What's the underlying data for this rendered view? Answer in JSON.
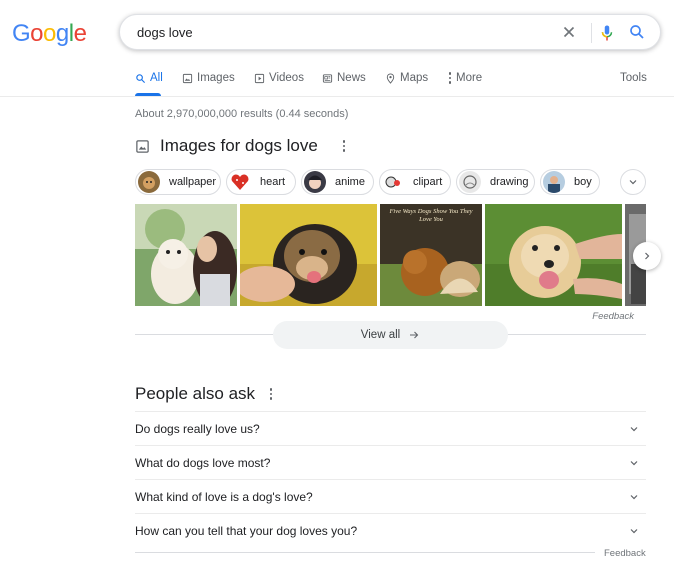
{
  "logo": {
    "letters": [
      "G",
      "o",
      "o",
      "g",
      "l",
      "e"
    ],
    "colors": [
      "#4285f4",
      "#ea4335",
      "#fbbc05",
      "#4285f4",
      "#34a853",
      "#ea4335"
    ]
  },
  "search": {
    "query": "dogs love"
  },
  "tabs": [
    {
      "label": "All",
      "icon": "search-icon"
    },
    {
      "label": "Images",
      "icon": "image-icon"
    },
    {
      "label": "Videos",
      "icon": "play-icon"
    },
    {
      "label": "News",
      "icon": "news-icon"
    },
    {
      "label": "Maps",
      "icon": "map-pin-icon"
    },
    {
      "label": "More",
      "icon": "kebab-icon"
    }
  ],
  "tools_label": "Tools",
  "result_stats": "About 2,970,000,000 results (0.44 seconds)",
  "images_section": {
    "title": "Images for dogs love",
    "chips": [
      "wallpaper",
      "heart",
      "anime",
      "clipart",
      "drawing",
      "boy"
    ],
    "photo_caption": "Five Ways Dogs Show You They Love You",
    "feedback": "Feedback",
    "view_all": "View all"
  },
  "people_also_ask": {
    "title": "People also ask",
    "questions": [
      "Do dogs really love us?",
      "What do dogs love most?",
      "What kind of love is a dog's love?",
      "How can you tell that your dog loves you?"
    ],
    "feedback": "Feedback"
  },
  "colors": {
    "accent": "#1a73e8",
    "mic_red": "#ea4335",
    "mic_blue": "#4285f4"
  }
}
